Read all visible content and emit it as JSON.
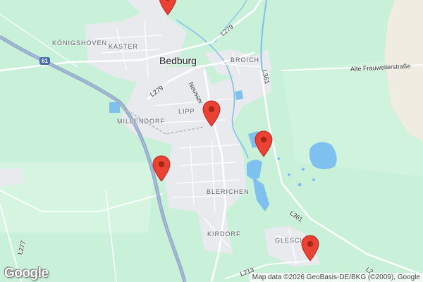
{
  "map": {
    "cities": {
      "bedburg": "Bedburg"
    },
    "places": {
      "konigshoven": "KÖNIGSHOVEN",
      "kaster": "KASTER",
      "broich": "BROICH",
      "lipp": "LIPP",
      "millendorf": "MILLENDORF",
      "blerichen": "BLERICHEN",
      "kirdorf": "KIRDORF",
      "glesch": "GLESCH"
    },
    "roads": {
      "l279_north": "L279",
      "l279_west": "L279",
      "l361_north": "L361",
      "l361_south": "L361",
      "l277": "L277",
      "neusser": "Neusser",
      "alte": "Alte Frauweilerstraße",
      "l213": "L213",
      "l_edge": "L2"
    },
    "highway": "61",
    "pins_count": 5,
    "logo": "Google",
    "attribution": "Map data ©2026 GeoBasis-DE/BKG (©2009), Google"
  },
  "colors": {
    "land": "#c9f0d8",
    "urban": "#e8eaed",
    "water": "#7ec0ee",
    "sand": "#f0ece2",
    "pin": "#ea4335",
    "motorway": "#8fa8c8"
  }
}
